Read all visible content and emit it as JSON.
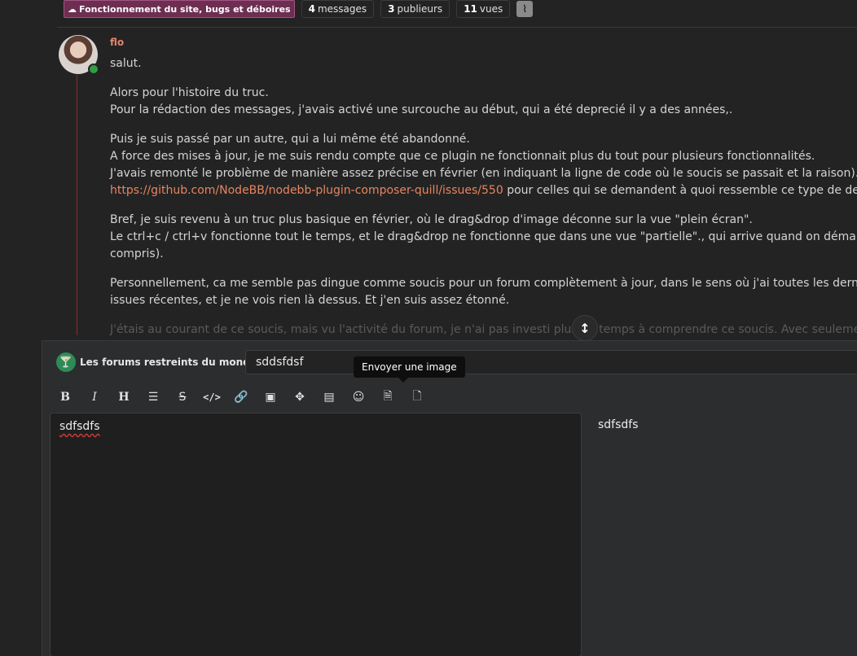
{
  "topic_bar": {
    "category": "Fonctionnement du site, bugs et déboires",
    "category_icon": "cloud-icon",
    "messages_count": "4",
    "messages_label": "messages",
    "posters_count": "3",
    "posters_label": "publieurs",
    "views_count": "11",
    "views_label": "vues",
    "rss_icon": "rss-icon"
  },
  "post": {
    "author": "flo",
    "greeting": "salut.",
    "p1_line1": "Alors pour l'histoire du truc.",
    "p1_line2": "Pour la rédaction des messages, j'avais activé une surcouche au début, qui a été deprecié il y a des années,.",
    "p2_line1": "Puis je suis passé par un autre, qui a lui même été abandonné.",
    "p2_line2": "A force des mises à jour, je me suis rendu compte que ce plugin ne fonctionnait plus du tout pour plusieurs fonctionnalités.",
    "p2_line3": "J'avais remonté le problème de manière assez précise en février (en indiquant la ligne de code où le soucis se passait et la raison). Mais... Pas de ré",
    "p2_link": "https://github.com/NodeBB/nodebb-plugin-composer-quill/issues/550",
    "p2_after_link": " pour celles qui se demandent à quoi ressemble ce type de demande)",
    "p3_line1": "Bref, je suis revenu à un truc plus basique en février, où le drag&drop d'image déconne sur la vue \"plein écran\".",
    "p3_line2": "Le ctrl+c / ctrl+v fonctionne tout le temps, et le drag&drop ne fonctionne que dans une vue \"partielle\"., qui arrive quand on démarrage la rédactio",
    "p3_line3": "compris).",
    "p4_line1": "Personnellement, ca me semble pas dingue comme soucis pour un forum complètement à jour, dans le sens où j'ai toutes les dernières mises à jou",
    "p4_line2": "issues récentes, et je ne vois rien là dessus. Et j'en suis assez étonné.",
    "p5_faded": "J'étais au courant de ce soucis, mais vu l'activité du forum, je n'ai pas investi plus de temps à comprendre ce soucis. Avec seulement quelques mes"
  },
  "composer": {
    "category_label": "Les forums restreints du monde T",
    "category_icon": "cocktail-icon",
    "title_value": "sddsfdsf",
    "tooltip": "Envoyer une image",
    "editor_text": "sdfsdfs",
    "preview_text": "sdfsdfs",
    "toolbar": [
      {
        "name": "bold",
        "glyph": "B"
      },
      {
        "name": "italic",
        "glyph": "I"
      },
      {
        "name": "heading",
        "glyph": "H"
      },
      {
        "name": "list",
        "glyph": "☰"
      },
      {
        "name": "strikethrough",
        "glyph": "S"
      },
      {
        "name": "code",
        "glyph": "</>"
      },
      {
        "name": "link",
        "glyph": "🔗"
      },
      {
        "name": "image",
        "glyph": "▣"
      },
      {
        "name": "fullscreen",
        "glyph": "✥"
      },
      {
        "name": "preview-card",
        "glyph": "▤"
      },
      {
        "name": "emoji",
        "glyph": "☺"
      },
      {
        "name": "upload-image",
        "glyph": "🗎"
      },
      {
        "name": "upload-file",
        "glyph": "🗋"
      }
    ]
  },
  "colors": {
    "accent": "#e7855f",
    "category_badge": "#6d2e52",
    "online": "#2f9e44"
  }
}
